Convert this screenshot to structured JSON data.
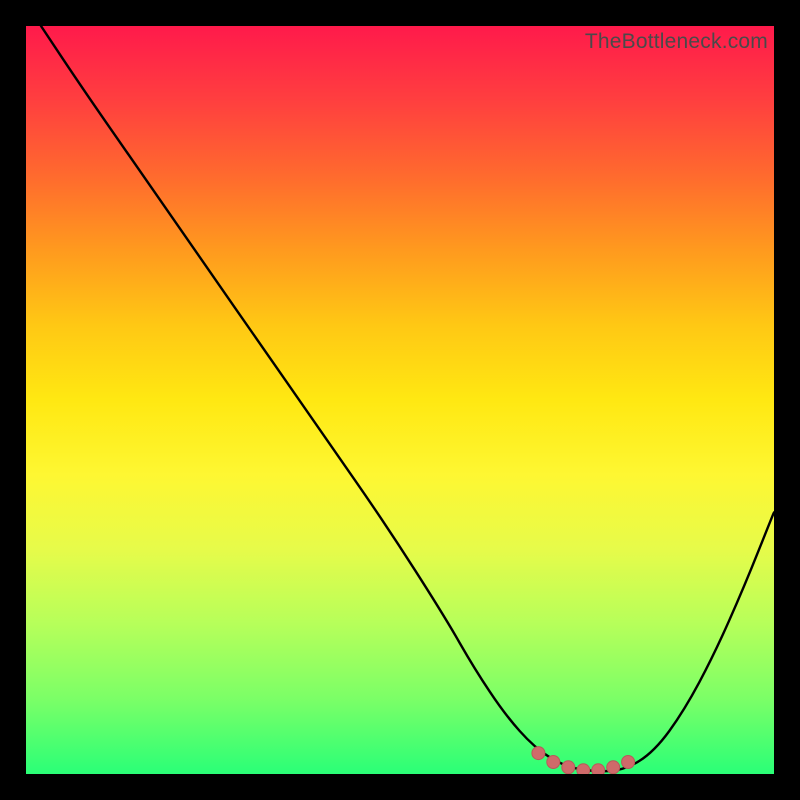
{
  "watermark": "TheBottleneck.com",
  "colors": {
    "gradient_stops": [
      "#ff1a4b",
      "#ff3f3f",
      "#ff6a2e",
      "#ff9a1e",
      "#ffc814",
      "#ffe812",
      "#fef732",
      "#e6fb4a",
      "#b6ff5a",
      "#7bff67",
      "#2aff77"
    ],
    "curve": "#000000",
    "marker_fill": "#cf6a6a",
    "marker_stroke": "#b85a5a",
    "frame_bg": "#000000"
  },
  "chart_data": {
    "type": "line",
    "title": "",
    "xlabel": "",
    "ylabel": "",
    "xlim": [
      0,
      100
    ],
    "ylim": [
      0,
      100
    ],
    "grid": false,
    "legend": null,
    "series": [
      {
        "name": "bottleneck-curve",
        "x": [
          2,
          8,
          16,
          24,
          32,
          40,
          48,
          56,
          60,
          64,
          68,
          72,
          76,
          80,
          84,
          88,
          92,
          96,
          100
        ],
        "y": [
          100,
          91,
          79.5,
          68,
          56.5,
          45,
          33.5,
          21,
          14,
          8,
          3.5,
          1,
          0.3,
          0.5,
          3,
          8.5,
          16,
          25,
          35
        ]
      }
    ],
    "markers": {
      "name": "highlight-band",
      "x": [
        68.5,
        70.5,
        72.5,
        74.5,
        76.5,
        78.5,
        80.5
      ],
      "y": [
        2.8,
        1.6,
        0.9,
        0.5,
        0.5,
        0.9,
        1.6
      ]
    }
  }
}
